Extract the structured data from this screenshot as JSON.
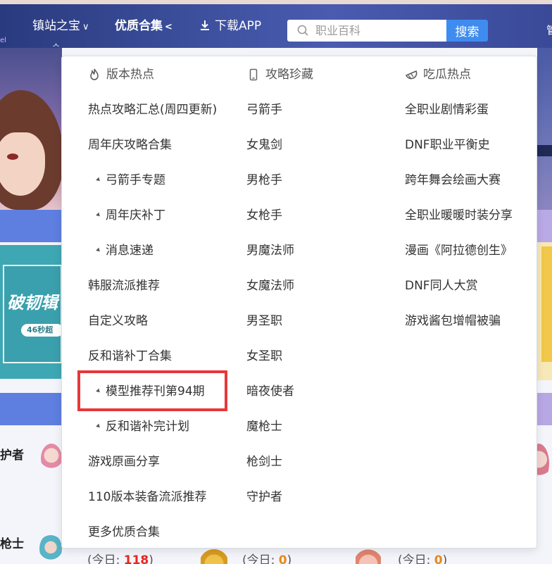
{
  "nav": {
    "item_treasure": "镇站之宝",
    "item_treasure_arrow": "∨",
    "item_quality": "优质合集",
    "item_quality_arrow": "<",
    "item_download": "下载APP",
    "search_placeholder": "职业百科",
    "search_button": "搜索"
  },
  "dropdown": {
    "columns": [
      {
        "header": "版本热点",
        "icon": "fire-icon",
        "items": [
          {
            "label": "热点攻略汇总(周四更新)",
            "sub": false
          },
          {
            "label": "周年庆攻略合集",
            "sub": false
          },
          {
            "label": "弓箭手专题",
            "sub": true
          },
          {
            "label": "周年庆补丁",
            "sub": true
          },
          {
            "label": "消息速递",
            "sub": true
          },
          {
            "label": "韩服流派推荐",
            "sub": false
          },
          {
            "label": "自定义攻略",
            "sub": false
          },
          {
            "label": "反和谐补丁合集",
            "sub": false
          },
          {
            "label": "模型推荐刊第94期",
            "sub": true
          },
          {
            "label": "反和谐补完计划",
            "sub": true
          },
          {
            "label": "游戏原画分享",
            "sub": false
          },
          {
            "label": "110版本装备流派推荐",
            "sub": false
          },
          {
            "label": "更多优质合集",
            "sub": false
          }
        ]
      },
      {
        "header": "攻略珍藏",
        "icon": "phone-icon",
        "items": [
          {
            "label": "弓箭手"
          },
          {
            "label": "女鬼剑"
          },
          {
            "label": "男枪手"
          },
          {
            "label": "女枪手"
          },
          {
            "label": "男魔法师"
          },
          {
            "label": "女魔法师"
          },
          {
            "label": "男圣职"
          },
          {
            "label": "女圣职"
          },
          {
            "label": "暗夜使者"
          },
          {
            "label": "魔枪士"
          },
          {
            "label": "枪剑士"
          },
          {
            "label": "守护者"
          }
        ]
      },
      {
        "header": "吃瓜热点",
        "icon": "melon-icon",
        "items": [
          {
            "label": "全职业剧情彩蛋"
          },
          {
            "label": "DNF职业平衡史"
          },
          {
            "label": "跨年舞会绘画大赛"
          },
          {
            "label": "全职业暖暖时装分享"
          },
          {
            "label": "漫画《阿拉德创生》"
          },
          {
            "label": "DNF同人大赏"
          },
          {
            "label": "游戏酱包增帽被骗"
          }
        ]
      }
    ]
  },
  "background": {
    "cover_title": "破韧辑",
    "cover_pill": "46秒超",
    "list_left_1": "护者",
    "list_left_2": "枪士",
    "today_prefix": "(今日: ",
    "today_suffix": ")",
    "today_counts": [
      "118",
      "0",
      "0"
    ]
  },
  "colors": {
    "nav_bg": "#3c4f9c",
    "search_button": "#3f8cf0",
    "highlight": "#e7373a",
    "count_red": "#e5281f",
    "count_orange": "#e58a1c"
  }
}
